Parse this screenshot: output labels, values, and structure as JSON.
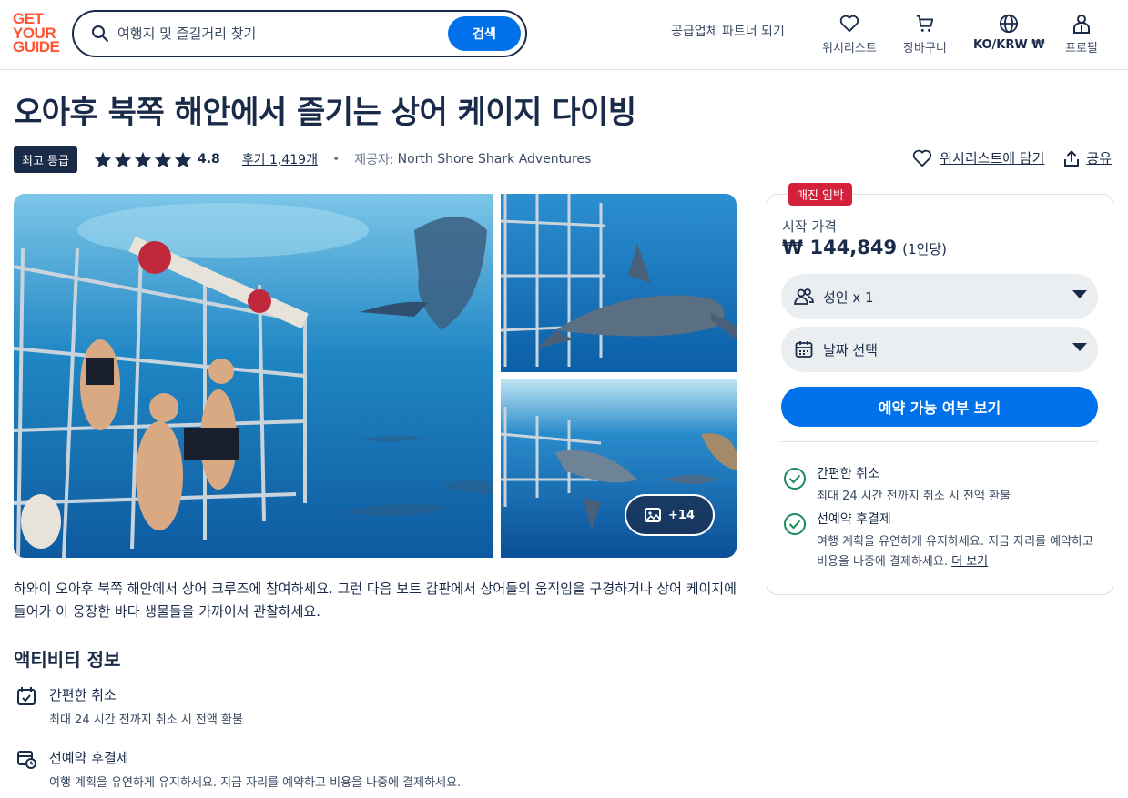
{
  "header": {
    "logo_lines": [
      "GET",
      "YOUR",
      "GUIDE"
    ],
    "search_placeholder": "여행지 및 즐길거리 찾기",
    "search_button": "검색",
    "partner_link": "공급업체 파트너 되기",
    "nav": [
      {
        "label": "위시리스트",
        "icon": "heart-icon"
      },
      {
        "label": "장바구니",
        "icon": "cart-icon"
      },
      {
        "label": "KO/KRW ₩",
        "icon": "globe-icon"
      },
      {
        "label": "프로필",
        "icon": "profile-icon"
      }
    ]
  },
  "activity": {
    "title": "오아후 북쪽 해안에서 즐기는 상어 케이지 다이빙",
    "badge": "최고 등급",
    "rating": "4.8",
    "stars": 5,
    "reviews": "후기 1,419개",
    "separator": "•",
    "provider_label": "제공자:",
    "provider": "North Shore Shark Adventures",
    "wishlist_action": "위시리스트에 담기",
    "share_action": "공유",
    "more_photos": "+14",
    "description": "하와이 오아후 북쪽 해안에서 상어 크루즈에 참여하세요. 그런 다음 보트 갑판에서 상어들의 움직임을 구경하거나 상어 케이지에 들어가 이 웅장한 바다 생물들을 가까이서 관찰하세요.",
    "info_title": "액티비티 정보",
    "info_items": [
      {
        "title": "간편한 취소",
        "desc": "최대 24 시간 전까지 취소 시 전액 환불",
        "icon": "calendar-check-icon"
      },
      {
        "title": "선예약 후결제",
        "desc": "여행 계획을 유연하게 유지하세요. 지금 자리를 예약하고 비용을 나중에 결제하세요.",
        "icon": "calendar-clock-icon"
      }
    ]
  },
  "booking": {
    "tag": "매진 임박",
    "from_label": "시작 가격",
    "price": "₩ 144,849",
    "per": "(1인당)",
    "participants": "성인 x 1",
    "date": "날짜 선택",
    "check_button": "예약 가능 여부 보기",
    "features": [
      {
        "title": "간편한 취소",
        "desc": "최대 24 시간 전까지 취소 시 전액 환불"
      },
      {
        "title": "선예약 후결제",
        "desc": "여행 계획을 유연하게 유지하세요. 지금 자리를 예약하고 비용을 나중에 결제하세요.",
        "link": "더 보기"
      }
    ]
  },
  "colors": {
    "brand": "#ff5533",
    "primary": "#0071eb",
    "navy": "#1a2b49",
    "urgent": "#d4213b",
    "check": "#1b8a5a"
  }
}
